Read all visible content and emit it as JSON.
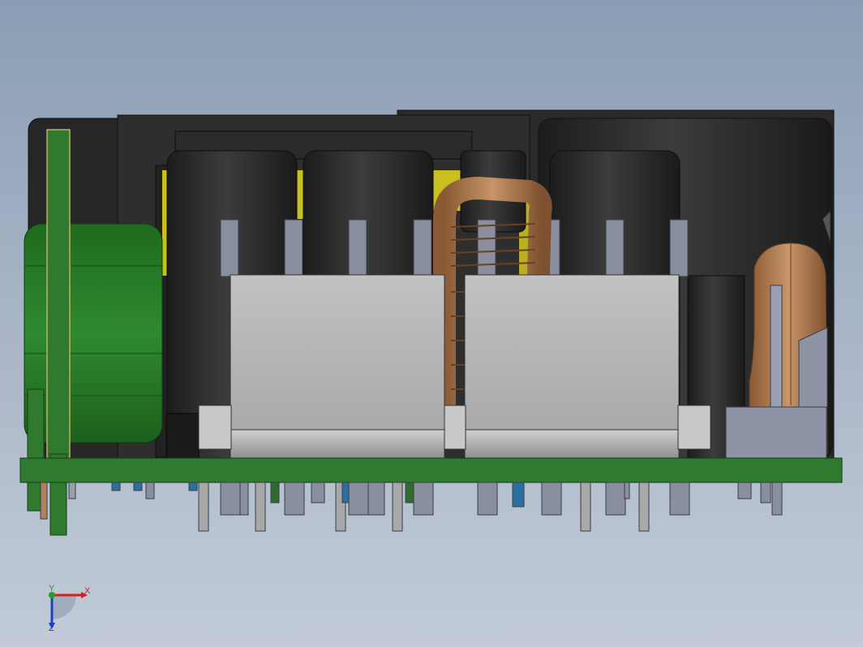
{
  "viewport": {
    "background_top": "#8a9db4",
    "background_bottom": "#c2cbd7"
  },
  "model": {
    "pcb_color": "#2f7a2f",
    "capacitor_color": "#2a2a2a",
    "heatsink_color": "#b4b4b4",
    "copper_color": "#b07a4a",
    "pin_color": "#8c8c8c"
  },
  "triad": {
    "x_label": "X",
    "y_label": "Y",
    "z_label": "Z",
    "x_color": "#d02020",
    "y_color": "#20a020",
    "z_color": "#2040c0"
  }
}
